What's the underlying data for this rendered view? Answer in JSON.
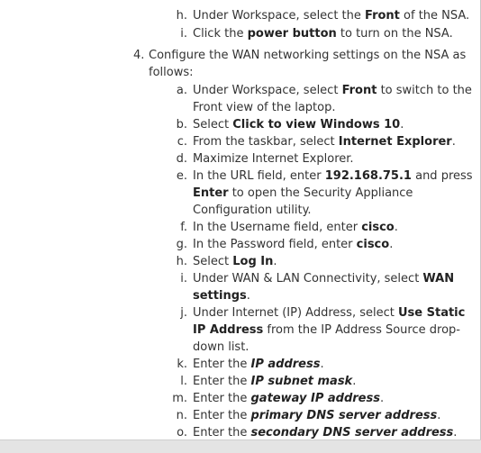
{
  "prev_items": {
    "h": {
      "label": "h.",
      "p1": "Under Workspace, select the ",
      "b1": "Front",
      "p2": " of the NSA."
    },
    "i": {
      "label": "i.",
      "p1": "Click the ",
      "b1": "power button",
      "p2": " to turn on the NSA."
    }
  },
  "step4": {
    "label": "4.",
    "text": "Configure the WAN networking settings on the NSA as follows:",
    "items": {
      "a": {
        "label": "a.",
        "p1": "Under Workspace, select ",
        "b1": "Front",
        "p2": " to switch to the Front view of the laptop."
      },
      "b": {
        "label": "b.",
        "p1": "Select ",
        "b1": "Click to view Windows 10",
        "p2": "."
      },
      "c": {
        "label": "c.",
        "p1": "From the taskbar, select ",
        "b1": "Internet Explorer",
        "p2": "."
      },
      "d": {
        "label": "d.",
        "p1": "Maximize Internet Explorer."
      },
      "e": {
        "label": "e.",
        "p1": "In the URL field, enter ",
        "b1": "192.168.75.1",
        "p2": " and press ",
        "b2": "Enter",
        "p3": " to open the Security Appliance Configuration utility."
      },
      "f": {
        "label": "f.",
        "p1": "In the Username field, enter ",
        "b1": "cisco",
        "p2": "."
      },
      "g": {
        "label": "g.",
        "p1": "In the Password field, enter ",
        "b1": "cisco",
        "p2": "."
      },
      "h": {
        "label": "h.",
        "p1": "Select ",
        "b1": "Log In",
        "p2": "."
      },
      "i": {
        "label": "i.",
        "p1": "Under WAN & LAN Connectivity, select ",
        "b1": "WAN settings",
        "p2": "."
      },
      "j": {
        "label": "j.",
        "p1": "Under Internet (IP) Address, select ",
        "b1": "Use Static IP Address",
        "p2": " from the IP Address Source drop-down list."
      },
      "k": {
        "label": "k.",
        "p1": "Enter the ",
        "bi1": "IP address",
        "p2": "."
      },
      "l": {
        "label": "l.",
        "p1": "Enter the ",
        "bi1": "IP subnet mask",
        "p2": "."
      },
      "m": {
        "label": "m.",
        "p1": "Enter the ",
        "bi1": "gateway IP address",
        "p2": "."
      },
      "n": {
        "label": "n.",
        "p1": "Enter the ",
        "bi1": "primary DNS server address",
        "p2": "."
      },
      "o": {
        "label": "o.",
        "p1": "Enter the ",
        "bi1": "secondary DNS server address",
        "p2": "."
      }
    }
  }
}
